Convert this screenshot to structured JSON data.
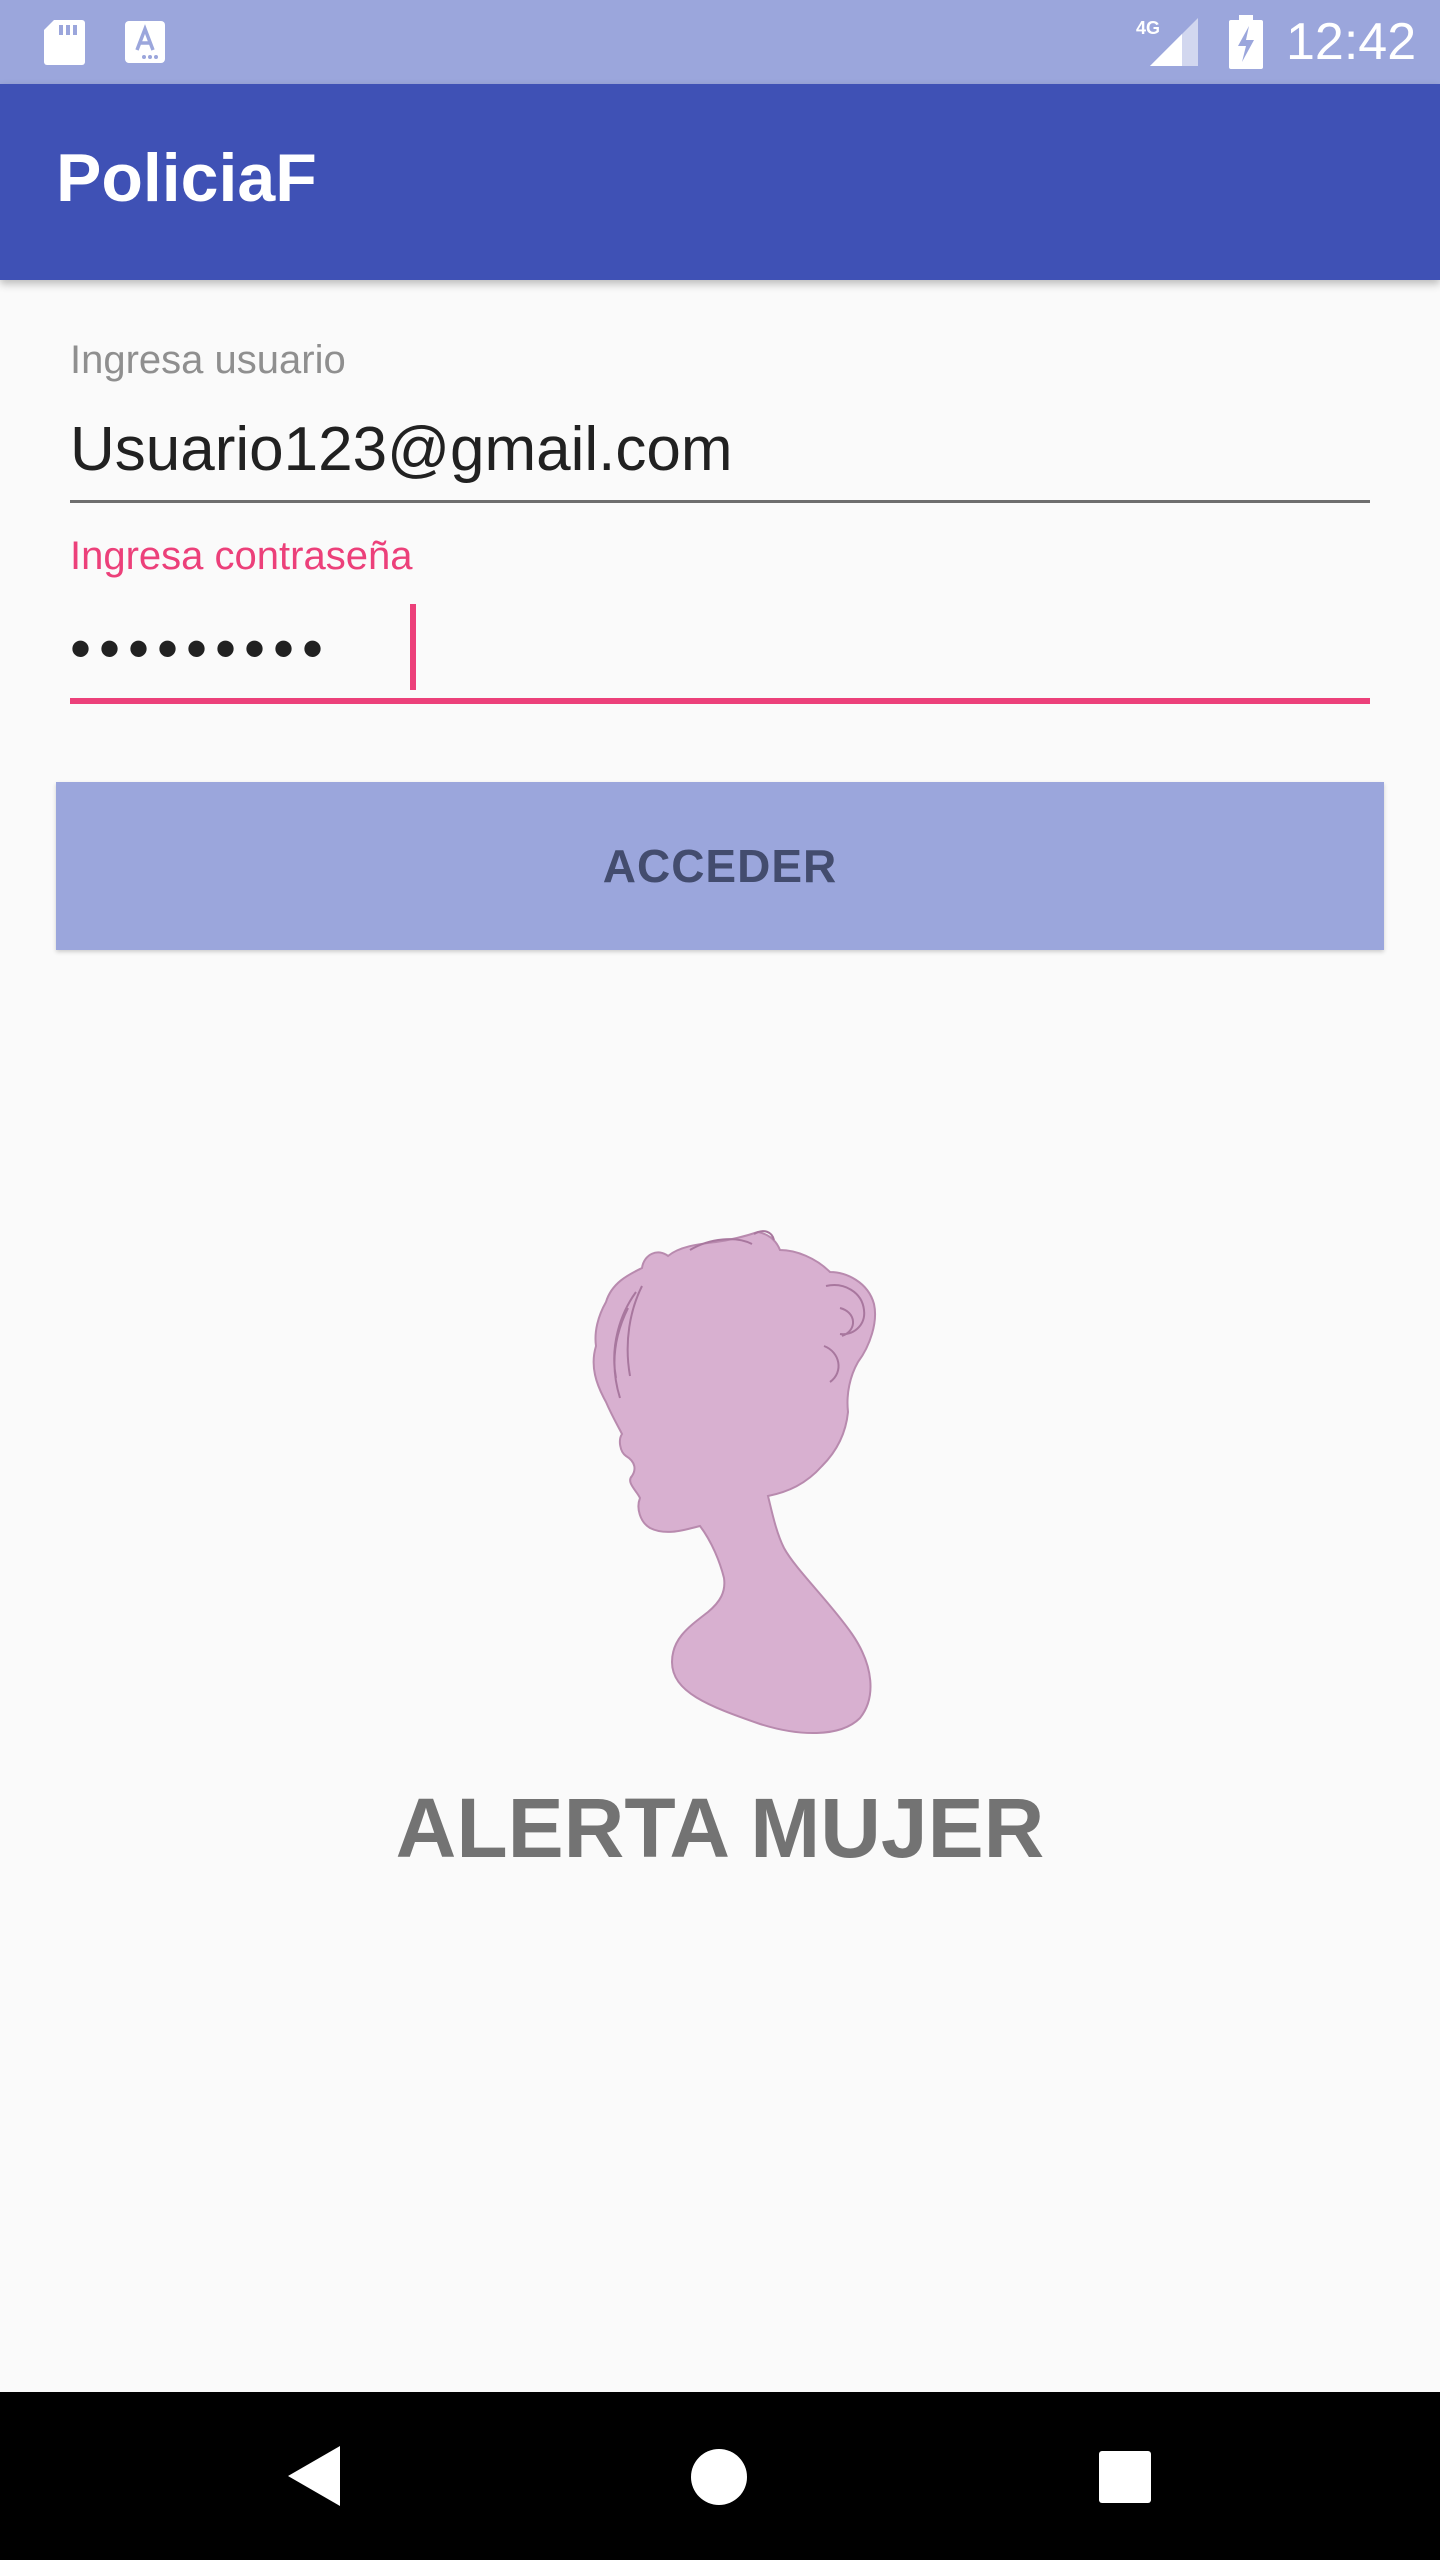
{
  "status_bar": {
    "time": "12:42",
    "network": "4G",
    "icons": [
      "sd-card-icon",
      "text-a-icon",
      "signal-4g-icon",
      "battery-charging-icon"
    ]
  },
  "app_bar": {
    "title": "PoliciaF"
  },
  "login_form": {
    "username_label": "Ingresa usuario",
    "username_value": "Usuario123@gmail.com",
    "password_label": "Ingresa contraseña",
    "password_value": "•••••••••",
    "submit_label": "ACCEDER"
  },
  "logo": {
    "text": "ALERTA MUJER",
    "icon": "woman-silhouette-icon"
  },
  "nav_bar": {
    "icons": [
      "back-icon",
      "home-icon",
      "recent-apps-icon"
    ]
  },
  "colors": {
    "primary": "#3f51b5",
    "primary_light": "#9ba6dc",
    "accent": "#ec407a",
    "silhouette": "#d8b0d0"
  }
}
